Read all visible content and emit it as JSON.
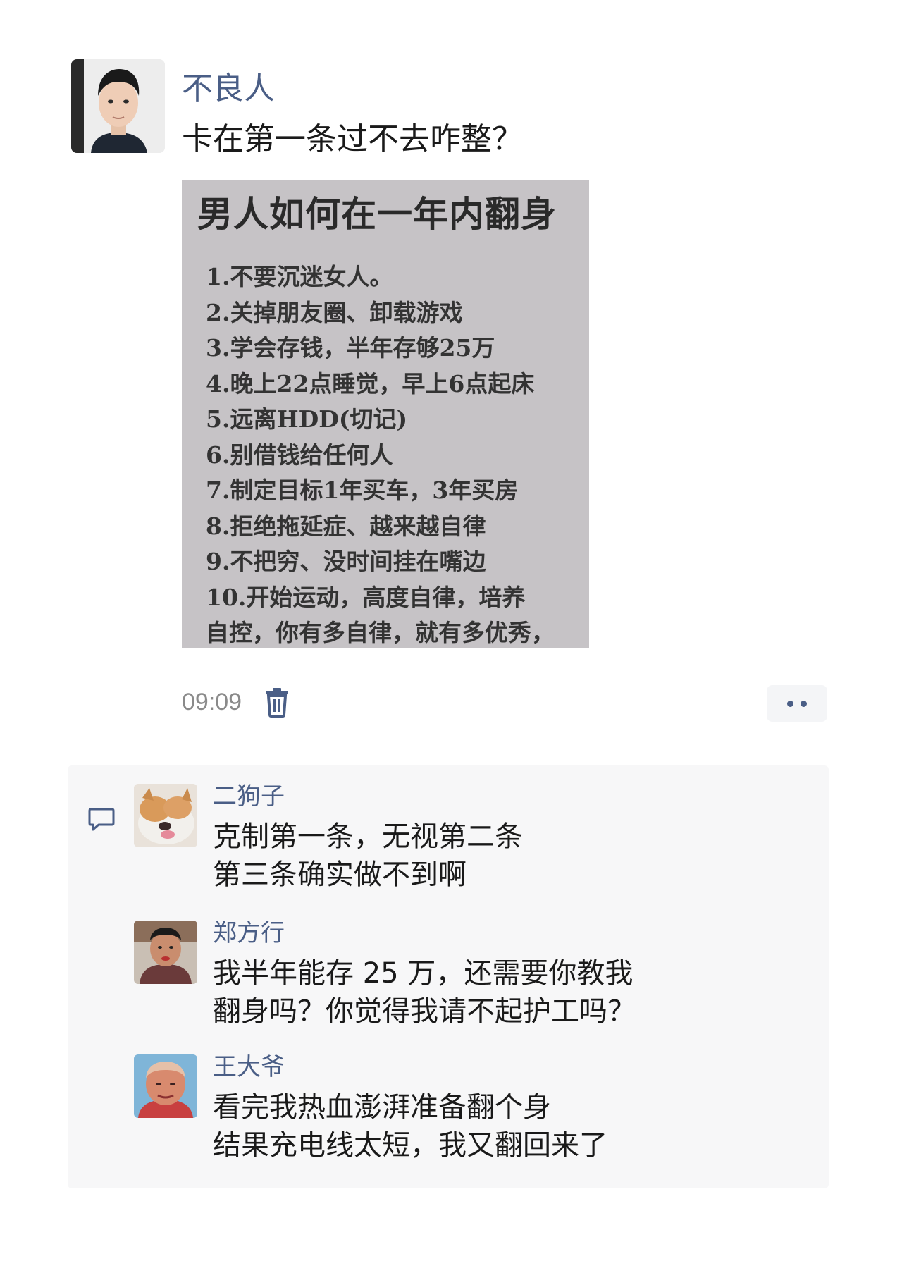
{
  "post": {
    "author": "不良人",
    "text": "卡在第一条过不去咋整？",
    "image": {
      "title": "男人如何在一年内翻身",
      "items": [
        "1.不要沉迷女人。",
        "2.关掉朋友圈、卸载游戏",
        "3.学会存钱，半年存够25万",
        "4.晚上22点睡觉，早上6点起床",
        "5.远离HDD(切记)",
        "6.别借钱给任何人",
        "7.制定目标1年买车，3年买房",
        "8.拒绝拖延症、越来越自律",
        "9.不把穷、没时间挂在嘴边",
        "10.开始运动，高度自律，培养",
        "自控，你有多自律，就有多优秀，"
      ]
    },
    "timestamp": "09:09"
  },
  "icons": {
    "delete": "trash-icon",
    "more": "more-dots-icon",
    "comment": "comment-bubble-icon"
  },
  "colors": {
    "name_blue": "#4a5e86",
    "comment_bg": "#f7f7f8"
  },
  "comments": [
    {
      "author": "二狗子",
      "lines": [
        "克制第一条，无视第二条",
        "第三条确实做不到啊"
      ]
    },
    {
      "author": "郑方行",
      "lines": [
        "我半年能存 25 万，还需要你教我",
        "翻身吗？你觉得我请不起护工吗？"
      ]
    },
    {
      "author": "王大爷",
      "lines": [
        "看完我热血澎湃准备翻个身",
        "结果充电线太短，我又翻回来了"
      ]
    }
  ]
}
